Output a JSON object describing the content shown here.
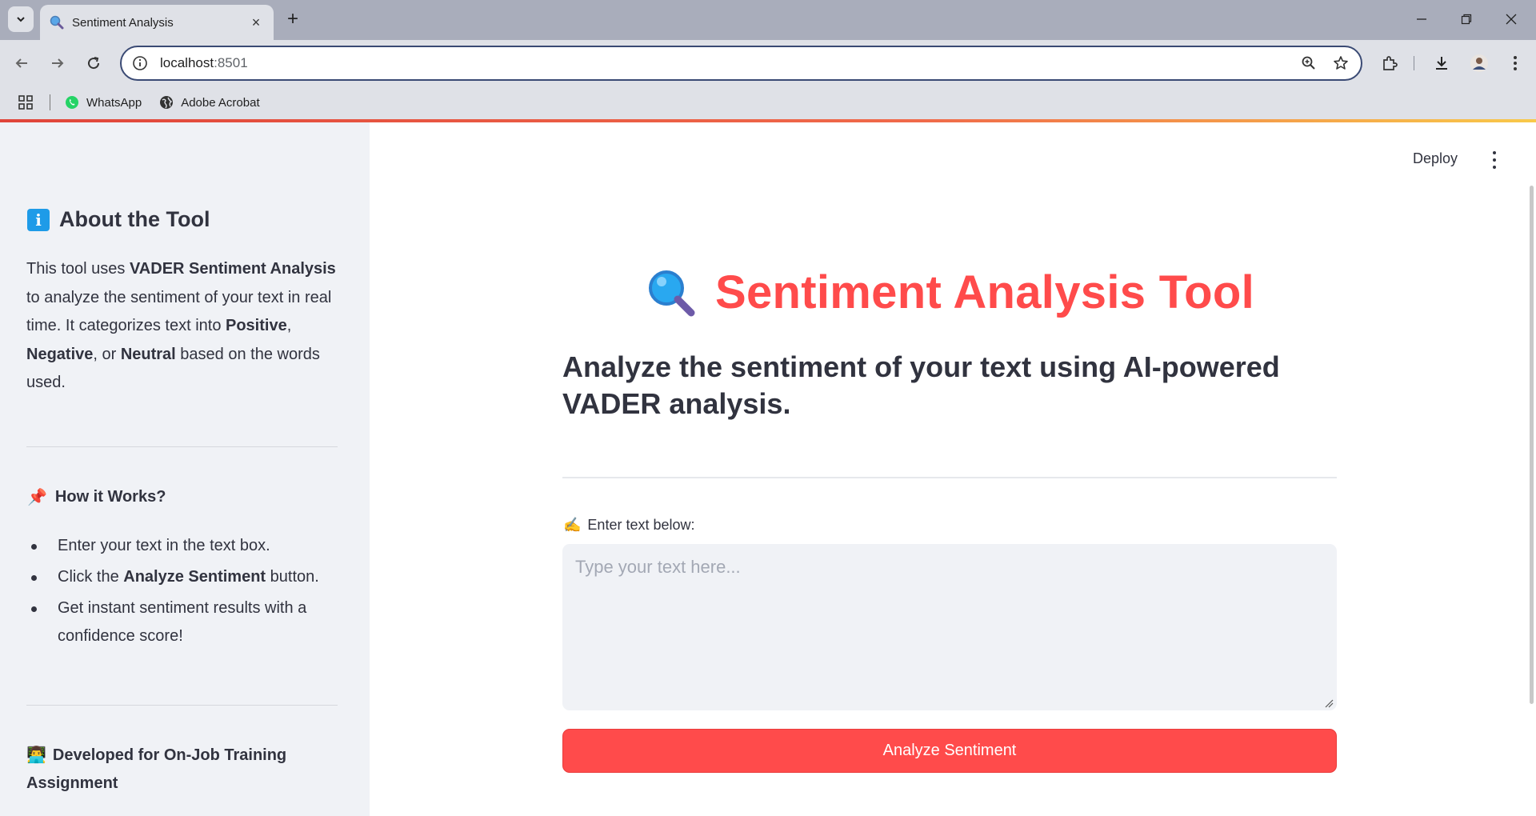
{
  "browser": {
    "tab_title": "Sentiment Analysis",
    "new_tab_symbol": "+",
    "close_symbol": "×",
    "url_host": "localhost",
    "url_port": ":8501",
    "bookmarks": [
      {
        "label": "WhatsApp",
        "icon": "whatsapp-icon"
      },
      {
        "label": "Adobe Acrobat",
        "icon": "globe-icon"
      }
    ]
  },
  "app": {
    "deploy_label": "Deploy",
    "title_emoji": "magnifier-icon",
    "title": "Sentiment Analysis Tool",
    "subtitle": "Analyze the sentiment of your text using AI-powered VADER analysis.",
    "input_label_emoji": "✍️",
    "input_label": "Enter text below:",
    "input_placeholder": "Type your text here...",
    "input_value": "",
    "analyze_button": "Analyze Sentiment"
  },
  "sidebar": {
    "about_heading": "About the Tool",
    "about_text": {
      "p1": "This tool uses ",
      "b1": "VADER Sentiment Analysis",
      "p2": " to analyze the sentiment of your text in real time. It categorizes text into ",
      "b2": "Positive",
      "p3": ", ",
      "b3": "Negative",
      "p4": ", or ",
      "b4": "Neutral",
      "p5": " based on the words used."
    },
    "how_emoji": "📌",
    "how_heading": "How it Works?",
    "steps": {
      "s1": "Enter your text in the text box.",
      "s2_pre": "Click the ",
      "s2_bold": "Analyze Sentiment",
      "s2_post": " button.",
      "s3": "Get instant sentiment results with a confidence score!"
    },
    "dev_emoji": "👨‍💻",
    "dev_text": "Developed for On-Job Training Assignment"
  },
  "colors": {
    "accent": "#ff4b4b",
    "sidebar_bg": "#f0f2f6",
    "text": "#31333f"
  }
}
